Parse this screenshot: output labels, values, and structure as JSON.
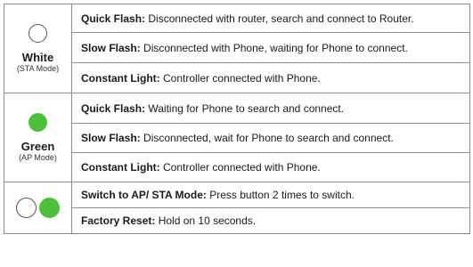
{
  "groups": {
    "white": {
      "name": "White",
      "sub": "(STA Mode)",
      "rows": [
        {
          "label": "Quick Flash:",
          "text": " Disconnected with router, search and connect to Router."
        },
        {
          "label": "Slow Flash:",
          "text": " Disconnected with Phone, waiting for Phone to connect."
        },
        {
          "label": "Constant Light:",
          "text": " Controller connected with Phone."
        }
      ]
    },
    "green": {
      "name": "Green",
      "sub": "(AP Mode)",
      "rows": [
        {
          "label": "Quick Flash:",
          "text": " Waiting for Phone to search and connect."
        },
        {
          "label": "Slow Flash:",
          "text": " Disconnected, wait for Phone to search and connect."
        },
        {
          "label": "Constant Light:",
          "text": " Controller connected with Phone."
        }
      ]
    },
    "button": {
      "rows": [
        {
          "label": "Switch to AP/ STA Mode:",
          "text": " Press button 2 times to switch."
        },
        {
          "label": "Factory Reset:",
          "text": " Hold on 10 seconds."
        }
      ]
    }
  },
  "colors": {
    "green_led": "#4cc03a",
    "white_led": "#ffffff",
    "border": "#8c8c8c"
  }
}
